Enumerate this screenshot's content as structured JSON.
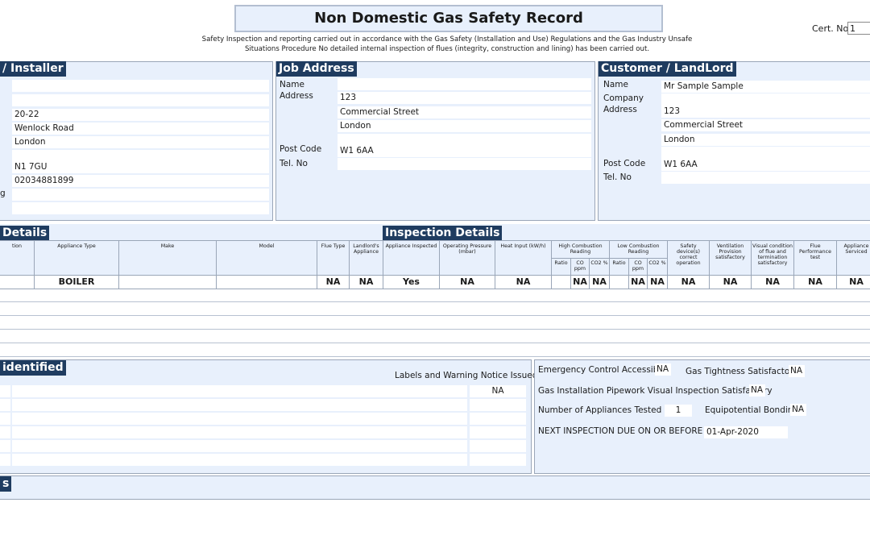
{
  "header": {
    "title": "Non Domestic Gas Safety Record",
    "subtitle_line1": "Safety Inspection and reporting carried out in accordance with the Gas Safety (Installation and Use) Regulations and the Gas Industry Unsafe",
    "subtitle_line2": "Situations Procedure No detailed internal inspection of flues (integrity, construction and lining) has been carried out.",
    "cert_label": "Cert. No.",
    "cert_value": "1"
  },
  "installer": {
    "heading": "/ Installer",
    "fields": [
      "",
      "",
      "20-22",
      "Wenlock Road",
      "London",
      "",
      "N1 7GU",
      "02034881899",
      "",
      ""
    ],
    "stray_label": "g"
  },
  "job_address": {
    "heading": "Job Address",
    "name_label": "Name",
    "address_label": "Address",
    "postcode_label": "Post Code",
    "tel_label": "Tel. No",
    "name": "",
    "address_lines": [
      "123",
      "Commercial Street",
      "London",
      ""
    ],
    "postcode": "W1 6AA",
    "tel": ""
  },
  "customer": {
    "heading": "Customer / LandLord",
    "name_label": "Name",
    "company_label": "Company",
    "address_label": "Address",
    "postcode_label": "Post Code",
    "tel_label": "Tel. No",
    "name": "Mr Sample Sample",
    "company": "",
    "address_lines": [
      "123",
      "Commercial Street",
      "London",
      ""
    ],
    "postcode": "W1 6AA",
    "tel": ""
  },
  "appliance": {
    "details_heading": "Details",
    "inspection_heading": "Inspection Details",
    "headers": {
      "location": "tion",
      "type": "Appliance Type",
      "make": "Make",
      "model": "Model",
      "flue_type": "Flue Type",
      "landlords": "Landlord's Appliance",
      "inspected": "Appliance Inspected",
      "pressure": "Operating Pressure (mbar)",
      "heat_input": "Heat Input (kW/h)",
      "high_comb": "High Combustion Reading",
      "low_comb": "Low Combustion Reading",
      "ratio": "Ratio",
      "co": "CO ppm",
      "co2": "CO2 %",
      "safety": "Safety device(s) correct operation",
      "ventilation": "Ventilation Provision satisfactory",
      "visual": "Visual condition of flue and termination satisfactory",
      "flue_perf": "Flue Performance test",
      "serviced": "Appliance Serviced"
    },
    "row": {
      "type": "BOILER",
      "flue_type": "NA",
      "landlords": "NA",
      "inspected": "Yes",
      "pressure": "NA",
      "heat_input": "NA",
      "high_co": "NA",
      "high_co2": "NA",
      "low_co": "NA",
      "low_co2": "NA",
      "safety": "NA",
      "ventilation": "NA",
      "visual": "NA",
      "flue_perf": "NA",
      "serviced": "NA"
    }
  },
  "defects": {
    "heading": "identified",
    "labels_heading": "Labels and Warning Notice Issued",
    "first_value": "NA"
  },
  "summary": {
    "emergency_label": "Emergency Control Accessible",
    "emergency_value": "NA",
    "tightness_label": "Gas Tightness Satisfactory",
    "tightness_value": "NA",
    "pipework_label": "Gas Installation Pipework Visual Inspection Satisfactory",
    "pipework_value": "NA",
    "tested_label": "Number of Appliances Tested",
    "tested_value": "1",
    "bonding_label": "Equipotential Bonding",
    "bonding_value": "NA",
    "next_label": "NEXT INSPECTION DUE ON OR BEFORE",
    "next_value": "01-Apr-2020"
  },
  "comments": {
    "heading": "s"
  }
}
